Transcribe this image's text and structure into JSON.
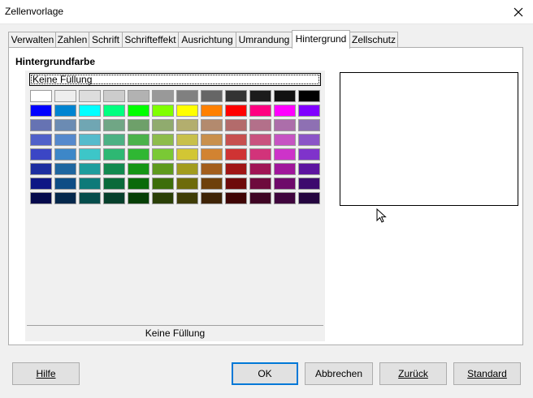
{
  "window": {
    "title": "Zellenvorlage"
  },
  "tabs": [
    {
      "label": "Verwalten"
    },
    {
      "label": "Zahlen"
    },
    {
      "label": "Schrift"
    },
    {
      "label": "Schrifteffekt"
    },
    {
      "label": "Ausrichtung"
    },
    {
      "label": "Umrandung"
    },
    {
      "label": "Hintergrund"
    },
    {
      "label": "Zellschutz"
    }
  ],
  "active_tab": "Hintergrund",
  "section": {
    "title": "Hintergrundfarbe"
  },
  "palette": {
    "no_fill_button": "Keine Füllung",
    "selected_caption": "Keine Füllung",
    "rows": [
      [
        "#ffffff",
        "#eeeeee",
        "#dddddd",
        "#cccccc",
        "#b2b2b2",
        "#999999",
        "#808080",
        "#666666",
        "#333333",
        "#1c1c1c",
        "#111111",
        "#000000"
      ],
      [
        "#0000ff",
        "#0084d1",
        "#00ffff",
        "#00ff80",
        "#00ff00",
        "#80ff00",
        "#ffff00",
        "#ff8000",
        "#ff0000",
        "#ff0080",
        "#ff00ff",
        "#8000ff"
      ],
      [
        "#6673b3",
        "#6b8bb3",
        "#70a6b3",
        "#70a685",
        "#6ea06a",
        "#90ab6e",
        "#b3ae6e",
        "#b38a6e",
        "#b36b6b",
        "#b3708a",
        "#ac6eaa",
        "#8e70b3"
      ],
      [
        "#5061c9",
        "#5589cd",
        "#55bbcc",
        "#4cb184",
        "#4bb24b",
        "#8dbc4b",
        "#c8c04b",
        "#c9904c",
        "#c7504f",
        "#c9537f",
        "#c654c3",
        "#8b55c7"
      ],
      [
        "#3b46c5",
        "#3d87c8",
        "#3dc6c8",
        "#2eb873",
        "#2fb733",
        "#7ac935",
        "#d2c634",
        "#d28331",
        "#cf3333",
        "#d2337a",
        "#cd33c9",
        "#7f33cb"
      ],
      [
        "#1e2fa0",
        "#1e66a0",
        "#1e9d9d",
        "#128a50",
        "#159515",
        "#5e9a1d",
        "#a29c1e",
        "#a35e1c",
        "#a01515",
        "#a01555",
        "#a0169b",
        "#5d14a0"
      ],
      [
        "#0e1785",
        "#0e4d85",
        "#0e7a79",
        "#0a6a3a",
        "#0a6a0a",
        "#3d6e0b",
        "#6e6b0b",
        "#6e400b",
        "#6e0a0a",
        "#6e0a3d",
        "#6e0a6a",
        "#3d0a6e"
      ],
      [
        "#050a4c",
        "#05284c",
        "#054d4c",
        "#06402c",
        "#063f06",
        "#2a3f06",
        "#3f3d06",
        "#3f2406",
        "#3f0505",
        "#3f0524",
        "#3f053d",
        "#24053f"
      ]
    ]
  },
  "buttons": {
    "help": "Hilfe",
    "ok": "OK",
    "cancel": "Abbrechen",
    "reset": "Zurück",
    "standard": "Standard"
  }
}
